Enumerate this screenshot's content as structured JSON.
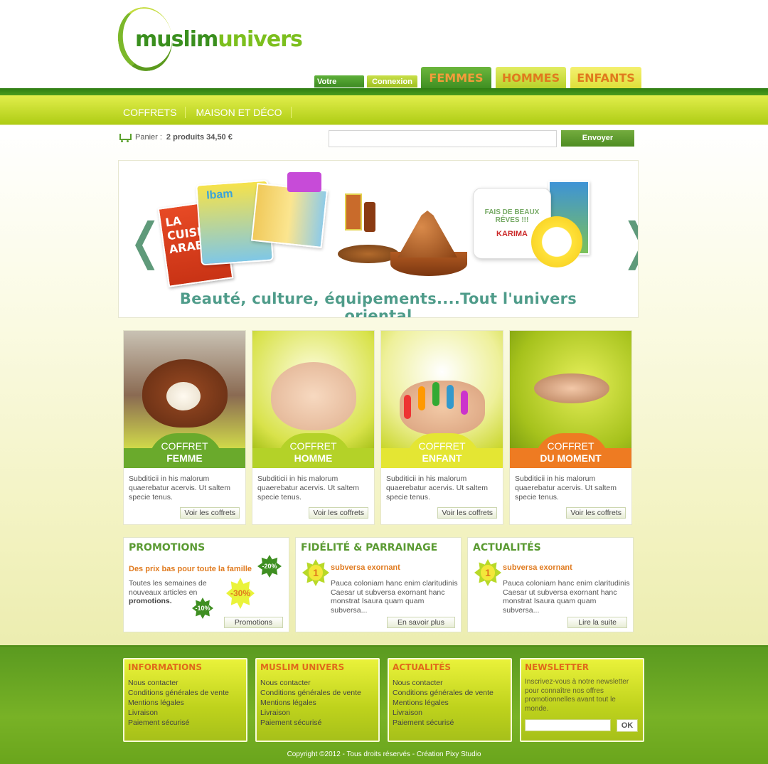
{
  "logo": {
    "text_a": "muslim",
    "text_b": "univers"
  },
  "tabs": {
    "account": "Votre compte",
    "login": "Connexion",
    "women": "FEMMES",
    "men": "HOMMES",
    "kids": "ENFANTS"
  },
  "menu": [
    "COFFRETS",
    "MAISON ET DÉCO"
  ],
  "cart": {
    "label": "Panier :",
    "summary": "2 produits 34,50 €"
  },
  "search": {
    "placeholder": "",
    "button": "Envoyer"
  },
  "slider": {
    "slogan": "Beauté, culture, équipements....Tout l'univers oriental",
    "prev": "❬",
    "next": "❭",
    "book1": "LA CUISINE ARABE",
    "book2": "Ibam",
    "pillow_text": "FAIS DE BEAUX RÊVES !!!",
    "pillow_name": "KARIMA"
  },
  "coffrets": [
    {
      "line1": "COFFRET",
      "line2": "FEMME",
      "desc": "Subditicii in his malorum quaerebatur acervis. Ut saltem specie tenus.",
      "btn": "Voir les coffrets"
    },
    {
      "line1": "COFFRET",
      "line2": "HOMME",
      "desc": "Subditicii in his malorum quaerebatur acervis. Ut saltem specie tenus.",
      "btn": "Voir les coffrets"
    },
    {
      "line1": "COFFRET",
      "line2": "ENFANT",
      "desc": "Subditicii in his malorum quaerebatur acervis. Ut saltem specie tenus.",
      "btn": "Voir les coffrets"
    },
    {
      "line1": "COFFRET",
      "line2": "DU MOMENT",
      "desc": "Subditicii in his malorum quaerebatur acervis. Ut saltem specie tenus.",
      "btn": "Voir les coffrets"
    }
  ],
  "promotions": {
    "title": "PROMOTIONS",
    "subtitle": "Des prix bas pour toute la famille",
    "text_a": "Toutes les semaines de nouveaux articles en",
    "text_b": "promotions.",
    "badge_a": "-20%",
    "badge_b": "-30%",
    "badge_c": "-10%",
    "btn": "Promotions"
  },
  "fidelite": {
    "title": "FIDÉLITÉ & PARRAINAGE",
    "badge": "1",
    "subtitle": "subversa exornant",
    "text": "Pauca coloniam hanc enim claritudinis Caesar ut subversa exornant hanc monstrat Isaura quam quam subversa...",
    "btn": "En savoir plus"
  },
  "actualites": {
    "title": "ACTUALITÉS",
    "badge": "1",
    "subtitle": "subversa exornant",
    "text": "Pauca coloniam hanc enim claritudinis Caesar ut subversa exornant hanc monstrat Isaura quam quam subversa...",
    "btn": "Lire la suite"
  },
  "footer": {
    "informations": {
      "title": "INFORMATIONS",
      "links": [
        "Nous contacter",
        "Conditions générales de vente",
        "Mentions légales",
        "Livraison",
        "Paiement sécurisé"
      ]
    },
    "muslim": {
      "title": "MUSLIM UNIVERS",
      "links": [
        "Nous contacter",
        "Conditions générales de vente",
        "Mentions légales",
        "Livraison",
        "Paiement sécurisé"
      ]
    },
    "actualites": {
      "title": "ACTUALITÉS",
      "links": [
        "Nous contacter",
        "Conditions générales de vente",
        "Mentions légales",
        "Livraison",
        "Paiement sécurisé"
      ]
    },
    "newsletter": {
      "title": "NEWSLETTER",
      "text": "Inscrivez-vous à notre newsletter pour connaître nos offres promotionnelles avant tout le monde.",
      "btn": "OK"
    },
    "copyright": "Copyright ©2012 - Tous droits réservés - Création Pixy Studio"
  }
}
